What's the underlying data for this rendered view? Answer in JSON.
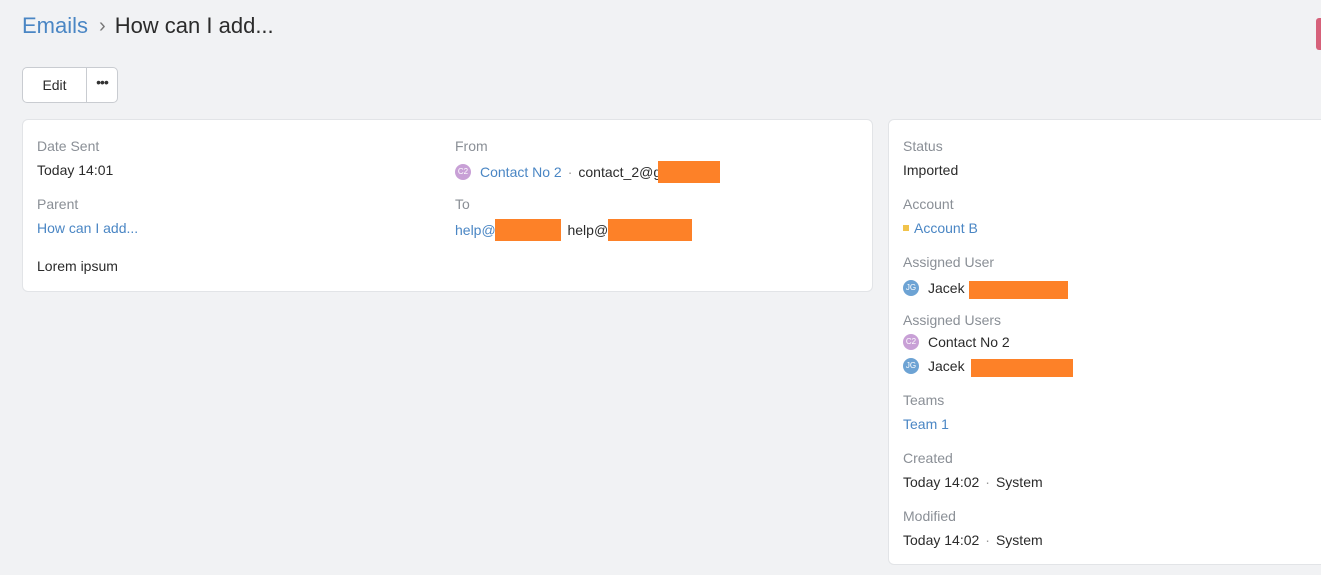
{
  "breadcrumb": {
    "root": "Emails",
    "separator": "›",
    "current": "How can I add..."
  },
  "actions": {
    "edit_label": "Edit",
    "more_label": "•••"
  },
  "main": {
    "date_sent": {
      "label": "Date Sent",
      "value": "Today 14:01"
    },
    "from": {
      "label": "From",
      "avatar": "C2",
      "name": "Contact No 2",
      "separator": "·",
      "email": "contact_2@g"
    },
    "parent": {
      "label": "Parent",
      "value": "How can I add..."
    },
    "to": {
      "label": "To",
      "first": "help@g",
      "second": "help@g"
    },
    "body": "Lorem ipsum"
  },
  "side": {
    "status": {
      "label": "Status",
      "value": "Imported"
    },
    "account": {
      "label": "Account",
      "value": "Account B",
      "icon_color": "#f1c34b"
    },
    "assigned_user": {
      "label": "Assigned User",
      "avatar": "JG",
      "name": "Jacek"
    },
    "assigned_users": {
      "label": "Assigned Users",
      "items": [
        {
          "avatar": "C2",
          "name": "Contact No 2"
        },
        {
          "avatar": "JG",
          "name": "Jacek"
        }
      ]
    },
    "teams": {
      "label": "Teams",
      "value": "Team 1"
    },
    "created": {
      "label": "Created",
      "date": "Today 14:02",
      "separator": "·",
      "by": "System"
    },
    "modified": {
      "label": "Modified",
      "date": "Today 14:02",
      "separator": "·",
      "by": "System"
    }
  },
  "colors": {
    "link": "#4a86c4",
    "redaction": "#fd8128",
    "accent_tab": "#d6617a"
  }
}
